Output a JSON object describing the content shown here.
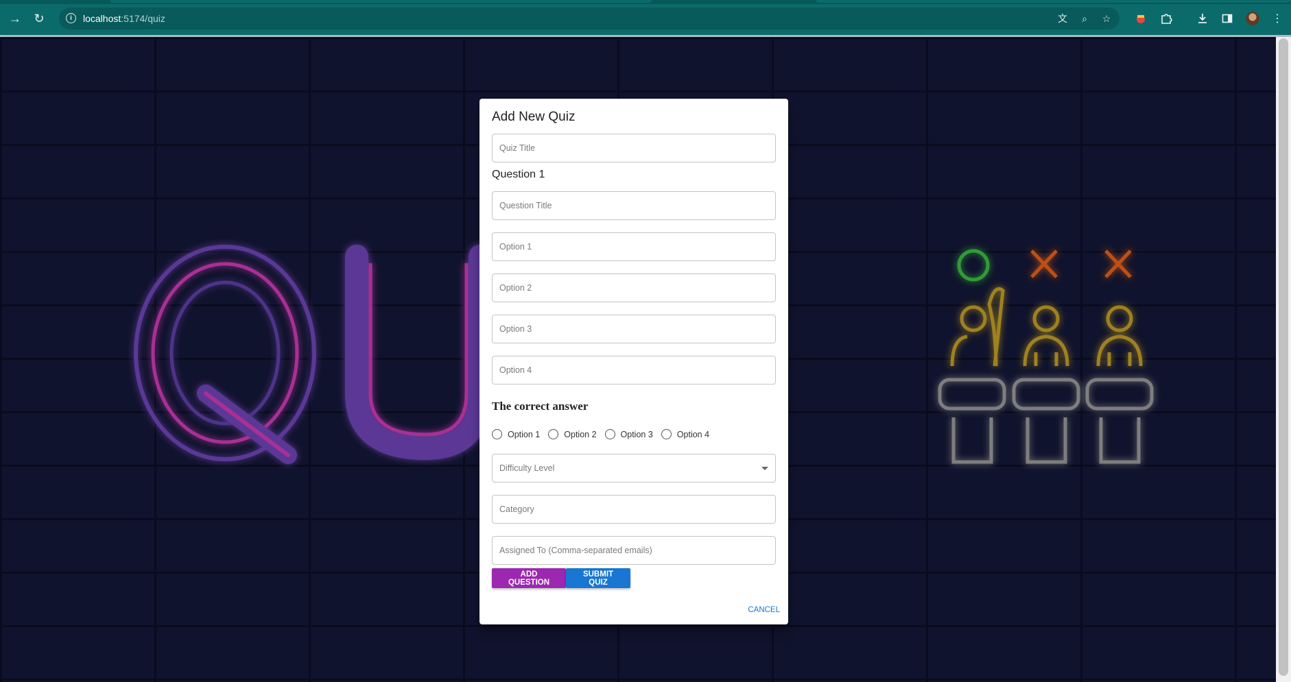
{
  "browser": {
    "url_host": "localhost",
    "url_path": ":5174/quiz"
  },
  "modal": {
    "title": "Add New Quiz",
    "quiz_title_placeholder": "Quiz Title",
    "question_label": "Question 1",
    "question_title_placeholder": "Question Title",
    "option_placeholders": [
      "Option 1",
      "Option 2",
      "Option 3",
      "Option 4"
    ],
    "correct_answer_heading": "The correct answer",
    "correct_answer_options": [
      "Option 1",
      "Option 2",
      "Option 3",
      "Option 4"
    ],
    "difficulty_placeholder": "Difficulty Level",
    "category_placeholder": "Category",
    "assigned_placeholder": "Assigned To (Comma-separated emails)",
    "add_question_label": "Add Question",
    "submit_quiz_label": "Submit Quiz",
    "cancel_label": "Cancel"
  },
  "colors": {
    "add_question": "#9c27b0",
    "submit_quiz": "#1976d2",
    "browser_toolbar": "#0b6b6b"
  }
}
